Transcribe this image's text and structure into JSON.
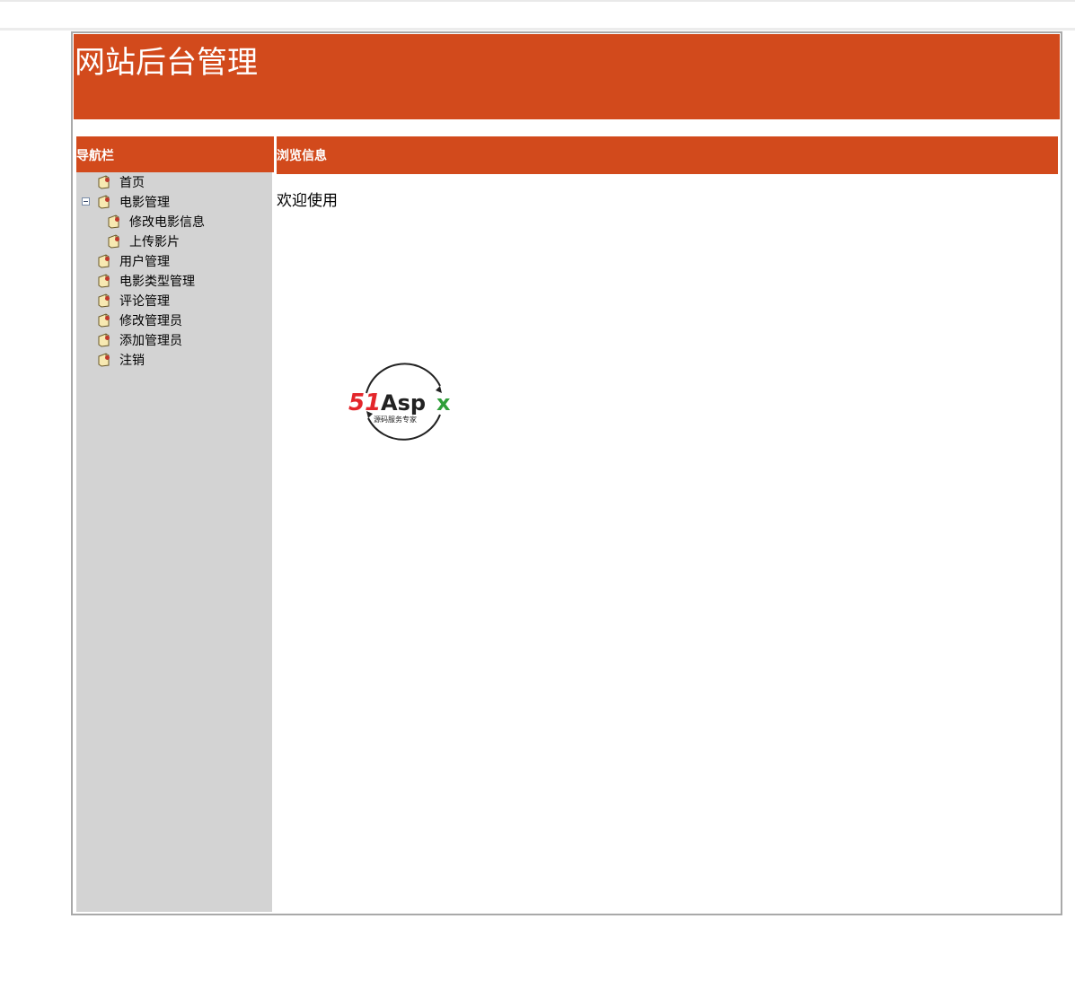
{
  "header": {
    "title": "网站后台管理"
  },
  "nav": {
    "title": "导航栏",
    "items": [
      {
        "label": "首页"
      },
      {
        "label": "电影管理"
      },
      {
        "label": "修改电影信息"
      },
      {
        "label": "上传影片"
      },
      {
        "label": "用户管理"
      },
      {
        "label": "电影类型管理"
      },
      {
        "label": "评论管理"
      },
      {
        "label": "修改管理员"
      },
      {
        "label": "添加管理员"
      },
      {
        "label": "注销"
      }
    ]
  },
  "main": {
    "title": "浏览信息",
    "welcome": "欢迎使用"
  },
  "watermark": {
    "brand": "51Aspx",
    "tagline": "源码服务专家"
  },
  "colors": {
    "header_bg": "#d24a1c",
    "nav_bg": "#d3d3d3",
    "frame_border": "#a9a9a9"
  }
}
